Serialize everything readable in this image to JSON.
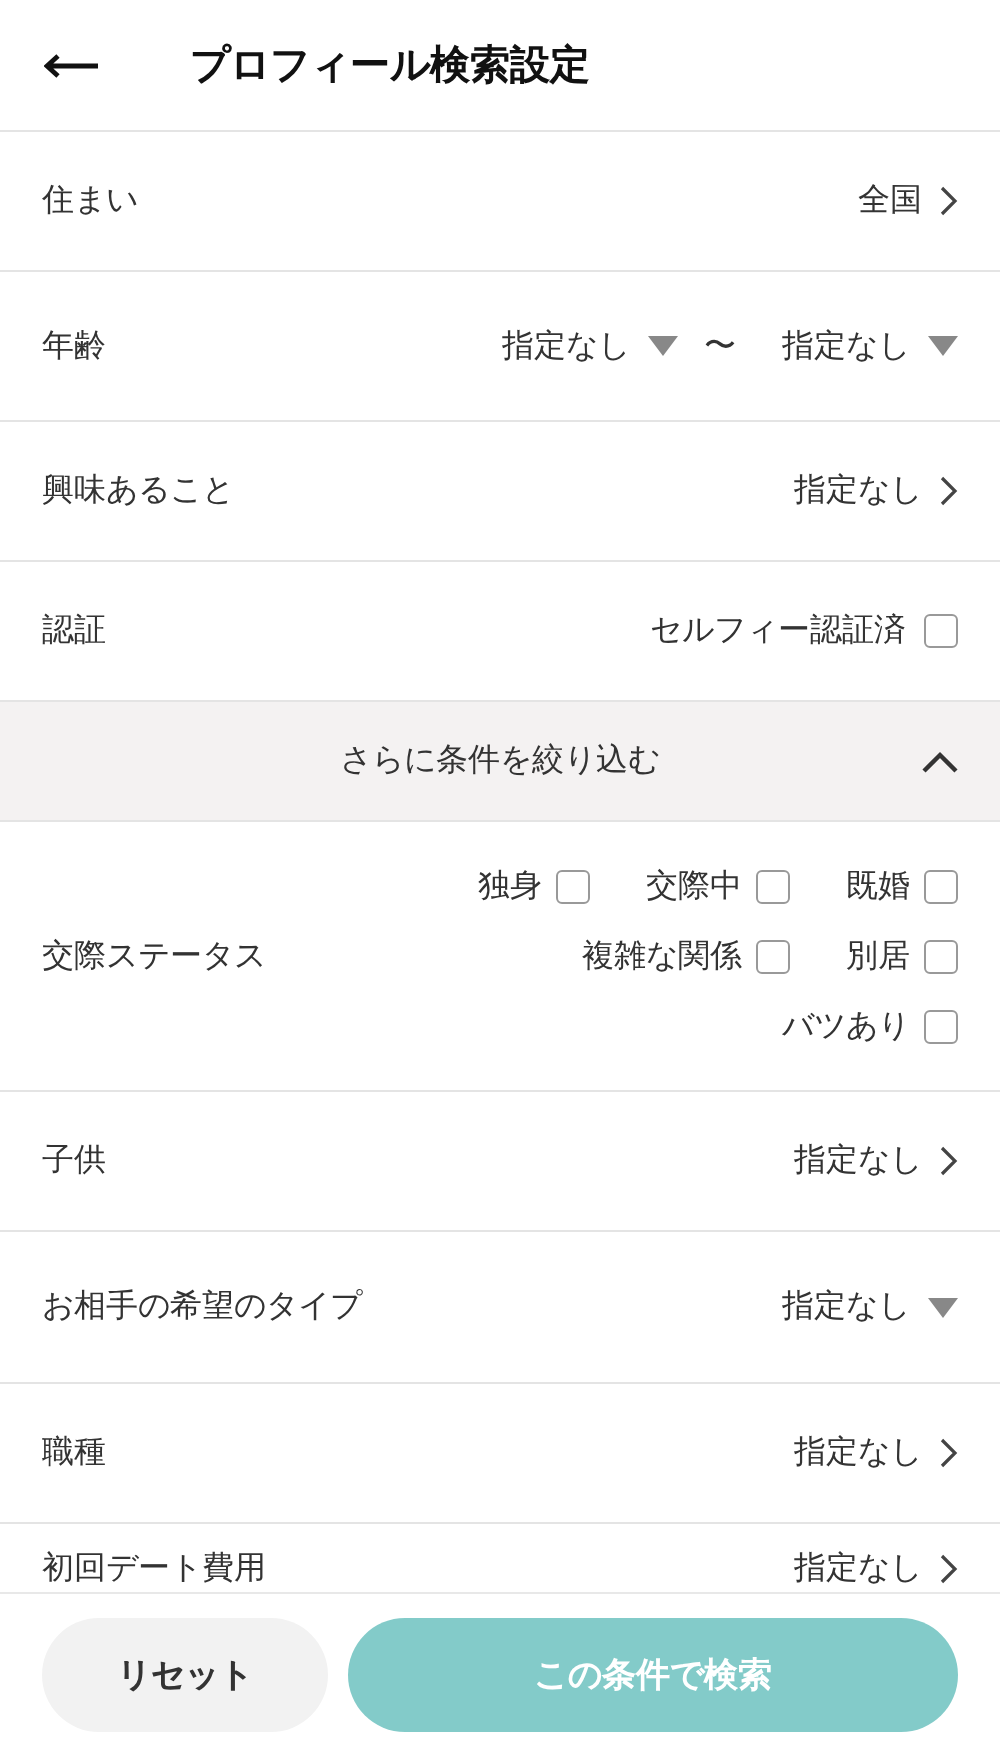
{
  "header": {
    "title": "プロフィール検索設定"
  },
  "rows": [
    {
      "kind": "link",
      "label": "住まい",
      "value": "全国"
    },
    {
      "kind": "range",
      "label": "年齢",
      "from": "指定なし",
      "separator": "〜",
      "to": "指定なし"
    },
    {
      "kind": "link",
      "label": "興味あること",
      "value": "指定なし"
    },
    {
      "kind": "checkbox",
      "label": "認証",
      "option": "セルフィー認証済",
      "checked": false
    }
  ],
  "more_section": {
    "label": "さらに条件を絞り込む",
    "expanded": true,
    "rows": [
      {
        "kind": "checkgroup",
        "label": "交際ステータス",
        "option_lines": [
          [
            {
              "label": "独身",
              "checked": false
            },
            {
              "label": "交際中",
              "checked": false
            },
            {
              "label": "既婚",
              "checked": false
            }
          ],
          [
            {
              "label": "複雑な関係",
              "checked": false
            },
            {
              "label": "別居",
              "checked": false
            }
          ],
          [
            {
              "label": "バツあり",
              "checked": false
            }
          ]
        ]
      },
      {
        "kind": "link",
        "label": "子供",
        "value": "指定なし"
      },
      {
        "kind": "dropdown",
        "label": "お相手の希望のタイプ",
        "value": "指定なし"
      },
      {
        "kind": "link",
        "label": "職種",
        "value": "指定なし"
      },
      {
        "kind": "link",
        "label": "初回デート費用",
        "value": "指定なし"
      }
    ]
  },
  "footer": {
    "reset": "リセット",
    "search": "この条件で検索"
  }
}
